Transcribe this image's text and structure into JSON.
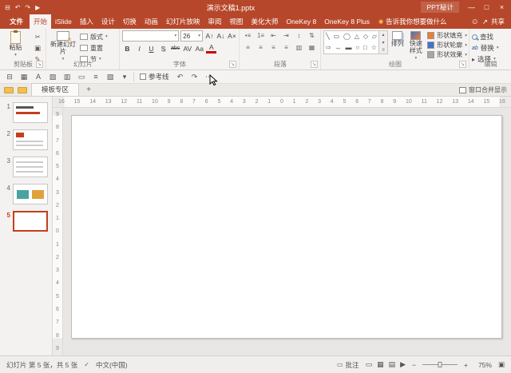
{
  "titlebar": {
    "title": "演示文稿1.pptx",
    "plugin": "PPT秘计",
    "min": "—",
    "max": "□",
    "close": "×",
    "qat": [
      {
        "key": "save",
        "glyph": "⊟"
      },
      {
        "key": "undo",
        "glyph": "↶"
      },
      {
        "key": "redo",
        "glyph": "↷"
      },
      {
        "key": "start-slideshow",
        "glyph": "▶"
      }
    ]
  },
  "tabs": {
    "file": "文件",
    "items": [
      {
        "key": "home",
        "label": "开始",
        "selected": true
      },
      {
        "key": "islide",
        "label": "iSlide"
      },
      {
        "key": "insert",
        "label": "插入"
      },
      {
        "key": "design",
        "label": "设计"
      },
      {
        "key": "transitions",
        "label": "切换"
      },
      {
        "key": "animations",
        "label": "动画"
      },
      {
        "key": "slideshow",
        "label": "幻灯片放映"
      },
      {
        "key": "review",
        "label": "审阅"
      },
      {
        "key": "view",
        "label": "视图"
      },
      {
        "key": "beautify-master",
        "label": "美化大师"
      },
      {
        "key": "onekey8",
        "label": "OneKey 8"
      },
      {
        "key": "onekey8plus",
        "label": "OneKey 8 Plus"
      }
    ],
    "tellme": "告诉我你想要做什么",
    "share": "共享"
  },
  "ribbon": {
    "clipboard": {
      "label": "剪贴板",
      "paste": "粘贴",
      "tools": [
        {
          "key": "cut",
          "glyph": "✂"
        },
        {
          "key": "copy",
          "glyph": "▣"
        },
        {
          "key": "format-painter",
          "glyph": "✎"
        }
      ]
    },
    "slides_group": {
      "label": "幻灯片",
      "new_slide": "新建幻灯片",
      "items": [
        {
          "key": "layout",
          "label": "版式",
          "caret": true
        },
        {
          "key": "reset",
          "label": "重置"
        },
        {
          "key": "section",
          "label": "节",
          "caret": true
        }
      ]
    },
    "font": {
      "label": "字体",
      "name_value": "",
      "size": "26",
      "tools1": [
        {
          "key": "increase-font",
          "glyph": "A↑"
        },
        {
          "key": "decrease-font",
          "glyph": "A↓"
        },
        {
          "key": "clear-format",
          "glyph": "A×"
        }
      ],
      "tools2": [
        {
          "key": "bold",
          "glyph": "B",
          "cls": "b"
        },
        {
          "key": "italic",
          "glyph": "I",
          "cls": "i"
        },
        {
          "key": "underline",
          "glyph": "U",
          "cls": "u"
        },
        {
          "key": "text-shadow",
          "glyph": "S",
          "cls": "sh"
        },
        {
          "key": "strikethrough",
          "glyph": "abc",
          "cls": "st"
        },
        {
          "key": "char-spacing",
          "glyph": "AV"
        },
        {
          "key": "change-case",
          "glyph": "Aa"
        },
        {
          "key": "font-color",
          "glyph": "A",
          "cls": "red-a"
        }
      ]
    },
    "paragraph": {
      "label": "段落",
      "row1": [
        {
          "key": "bullets",
          "glyph": "•≡"
        },
        {
          "key": "numbering",
          "glyph": "1≡"
        },
        {
          "key": "decrease-indent",
          "glyph": "⇤"
        },
        {
          "key": "increase-indent",
          "glyph": "⇥"
        },
        {
          "key": "line-spacing",
          "glyph": "↕"
        },
        {
          "key": "text-direction",
          "glyph": "⇅"
        }
      ],
      "row2": [
        {
          "key": "align-left",
          "glyph": "≡"
        },
        {
          "key": "align-center",
          "glyph": "≡"
        },
        {
          "key": "align-right",
          "glyph": "≡"
        },
        {
          "key": "justify",
          "glyph": "≡"
        },
        {
          "key": "columns",
          "glyph": "▥"
        },
        {
          "key": "smartart",
          "glyph": "▦"
        }
      ]
    },
    "drawing": {
      "label": "绘图",
      "gallery": [
        [
          "╲",
          "▭",
          "◯",
          "△",
          "◇",
          "▱"
        ],
        [
          "⇨",
          "↔",
          "▬",
          "○",
          "□",
          "☆"
        ]
      ],
      "gallery_scroll": [
        "▴",
        "▾",
        "≡"
      ],
      "arrange": "排列",
      "quick_styles": "快速样式",
      "fills": [
        {
          "key": "shape-fill",
          "label": "形状填充",
          "color": "#ed7d31"
        },
        {
          "key": "shape-outline",
          "label": "形状轮廓",
          "color": "#4472c4"
        },
        {
          "key": "shape-effects",
          "label": "形状效果",
          "color": "#a6a6a6"
        }
      ]
    },
    "editing": {
      "label": "编辑",
      "items": [
        {
          "key": "find",
          "label": "查找"
        },
        {
          "key": "replace",
          "label": "替换",
          "caret": true
        },
        {
          "key": "select",
          "label": "选择",
          "caret": true
        }
      ]
    }
  },
  "quickbar": {
    "left": [
      {
        "key": "save",
        "glyph": "⊟"
      },
      {
        "key": "view-grid",
        "glyph": "▦"
      },
      {
        "key": "textbox",
        "glyph": "A"
      },
      {
        "key": "picture",
        "glyph": "▨"
      },
      {
        "key": "table",
        "glyph": "▥"
      },
      {
        "key": "shape",
        "glyph": "▭"
      },
      {
        "key": "align",
        "glyph": "≡"
      },
      {
        "key": "color",
        "glyph": "▧"
      },
      {
        "key": "dropdown",
        "glyph": "▾"
      }
    ],
    "guides": "参考线",
    "right": [
      {
        "key": "undo",
        "glyph": "↶"
      },
      {
        "key": "redo",
        "glyph": "↷"
      },
      {
        "key": "more",
        "glyph": "⋯"
      }
    ]
  },
  "doctabs": {
    "tab": "模板专区",
    "add": "+",
    "right": "窗口合并显示"
  },
  "ruler": {
    "h": [
      "16",
      "15",
      "14",
      "13",
      "12",
      "11",
      "10",
      "9",
      "8",
      "7",
      "6",
      "5",
      "4",
      "3",
      "2",
      "1",
      "0",
      "1",
      "2",
      "3",
      "4",
      "5",
      "6",
      "7",
      "8",
      "9",
      "10",
      "11",
      "12",
      "13",
      "14",
      "15",
      "16"
    ],
    "v": [
      "9",
      "8",
      "7",
      "6",
      "5",
      "4",
      "3",
      "2",
      "1",
      "0",
      "1",
      "2",
      "3",
      "4",
      "5",
      "6",
      "7",
      "8",
      "9"
    ]
  },
  "slides": [
    {
      "num": "1",
      "sketch": "cover"
    },
    {
      "num": "2",
      "sketch": "header"
    },
    {
      "num": "3",
      "sketch": "text"
    },
    {
      "num": "4",
      "sketch": "images"
    },
    {
      "num": "5",
      "sketch": "blank",
      "selected": true
    }
  ],
  "statusbar": {
    "slide_info": "幻灯片 第 5 张，共 5 张",
    "spell": "✓",
    "lang": "中文(中国)",
    "comments": "批注",
    "comments_icon": "▭",
    "views": [
      {
        "key": "normal-view",
        "glyph": "▭"
      },
      {
        "key": "slide-sorter-view",
        "glyph": "▦"
      },
      {
        "key": "reading-view",
        "glyph": "▤"
      },
      {
        "key": "slideshow-view",
        "glyph": "▶"
      }
    ],
    "zoom_out": "−",
    "zoom_in": "+",
    "zoom": "75%",
    "fit": "▣"
  }
}
